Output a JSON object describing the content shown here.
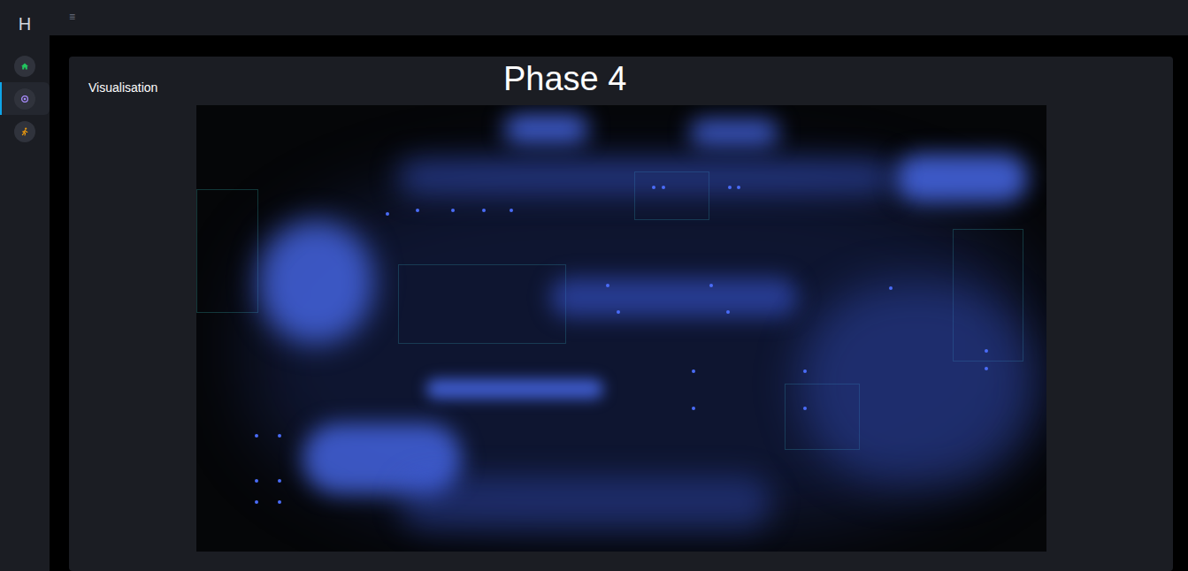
{
  "sidebar": {
    "logo": "H",
    "items": [
      {
        "kind": "home",
        "selected": false
      },
      {
        "kind": "target",
        "selected": true
      },
      {
        "kind": "runner",
        "selected": false
      }
    ]
  },
  "topbar": {
    "menu": "≡"
  },
  "card": {
    "title": "Visualisation",
    "heading": "Phase 4"
  }
}
